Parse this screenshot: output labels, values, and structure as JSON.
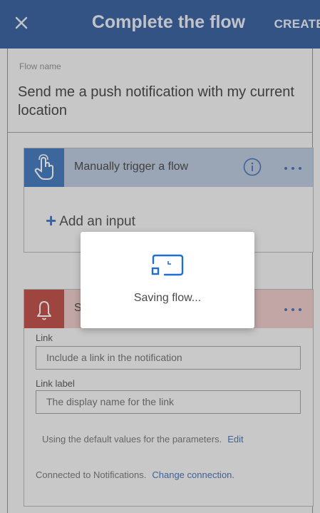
{
  "header": {
    "title": "Complete the flow",
    "create_label": "CREATE",
    "close_icon": "close-icon"
  },
  "flow_name": {
    "label": "Flow name",
    "value": "Send me a push notification with my current location"
  },
  "trigger_card": {
    "title": "Manually trigger a flow",
    "icon": "touch-hand-icon",
    "add_input_label": "Add an input"
  },
  "notify_card": {
    "title_visible": "S",
    "icon": "bell-icon",
    "link_label": "Link",
    "link_placeholder": "Include a link in the notification",
    "link_label_label": "Link label",
    "link_label_placeholder": "The display name for the link",
    "defaults_text": "Using the default values for the parameters.",
    "edit_label": "Edit",
    "connected_text": "Connected to Notifications.",
    "change_connection_label": "Change connection."
  },
  "modal": {
    "text": "Saving flow..."
  },
  "colors": {
    "header_bg": "#0f3f8a",
    "trigger_accent": "#1c5fb0",
    "notify_accent": "#b42a23",
    "link": "#1f57a8"
  }
}
